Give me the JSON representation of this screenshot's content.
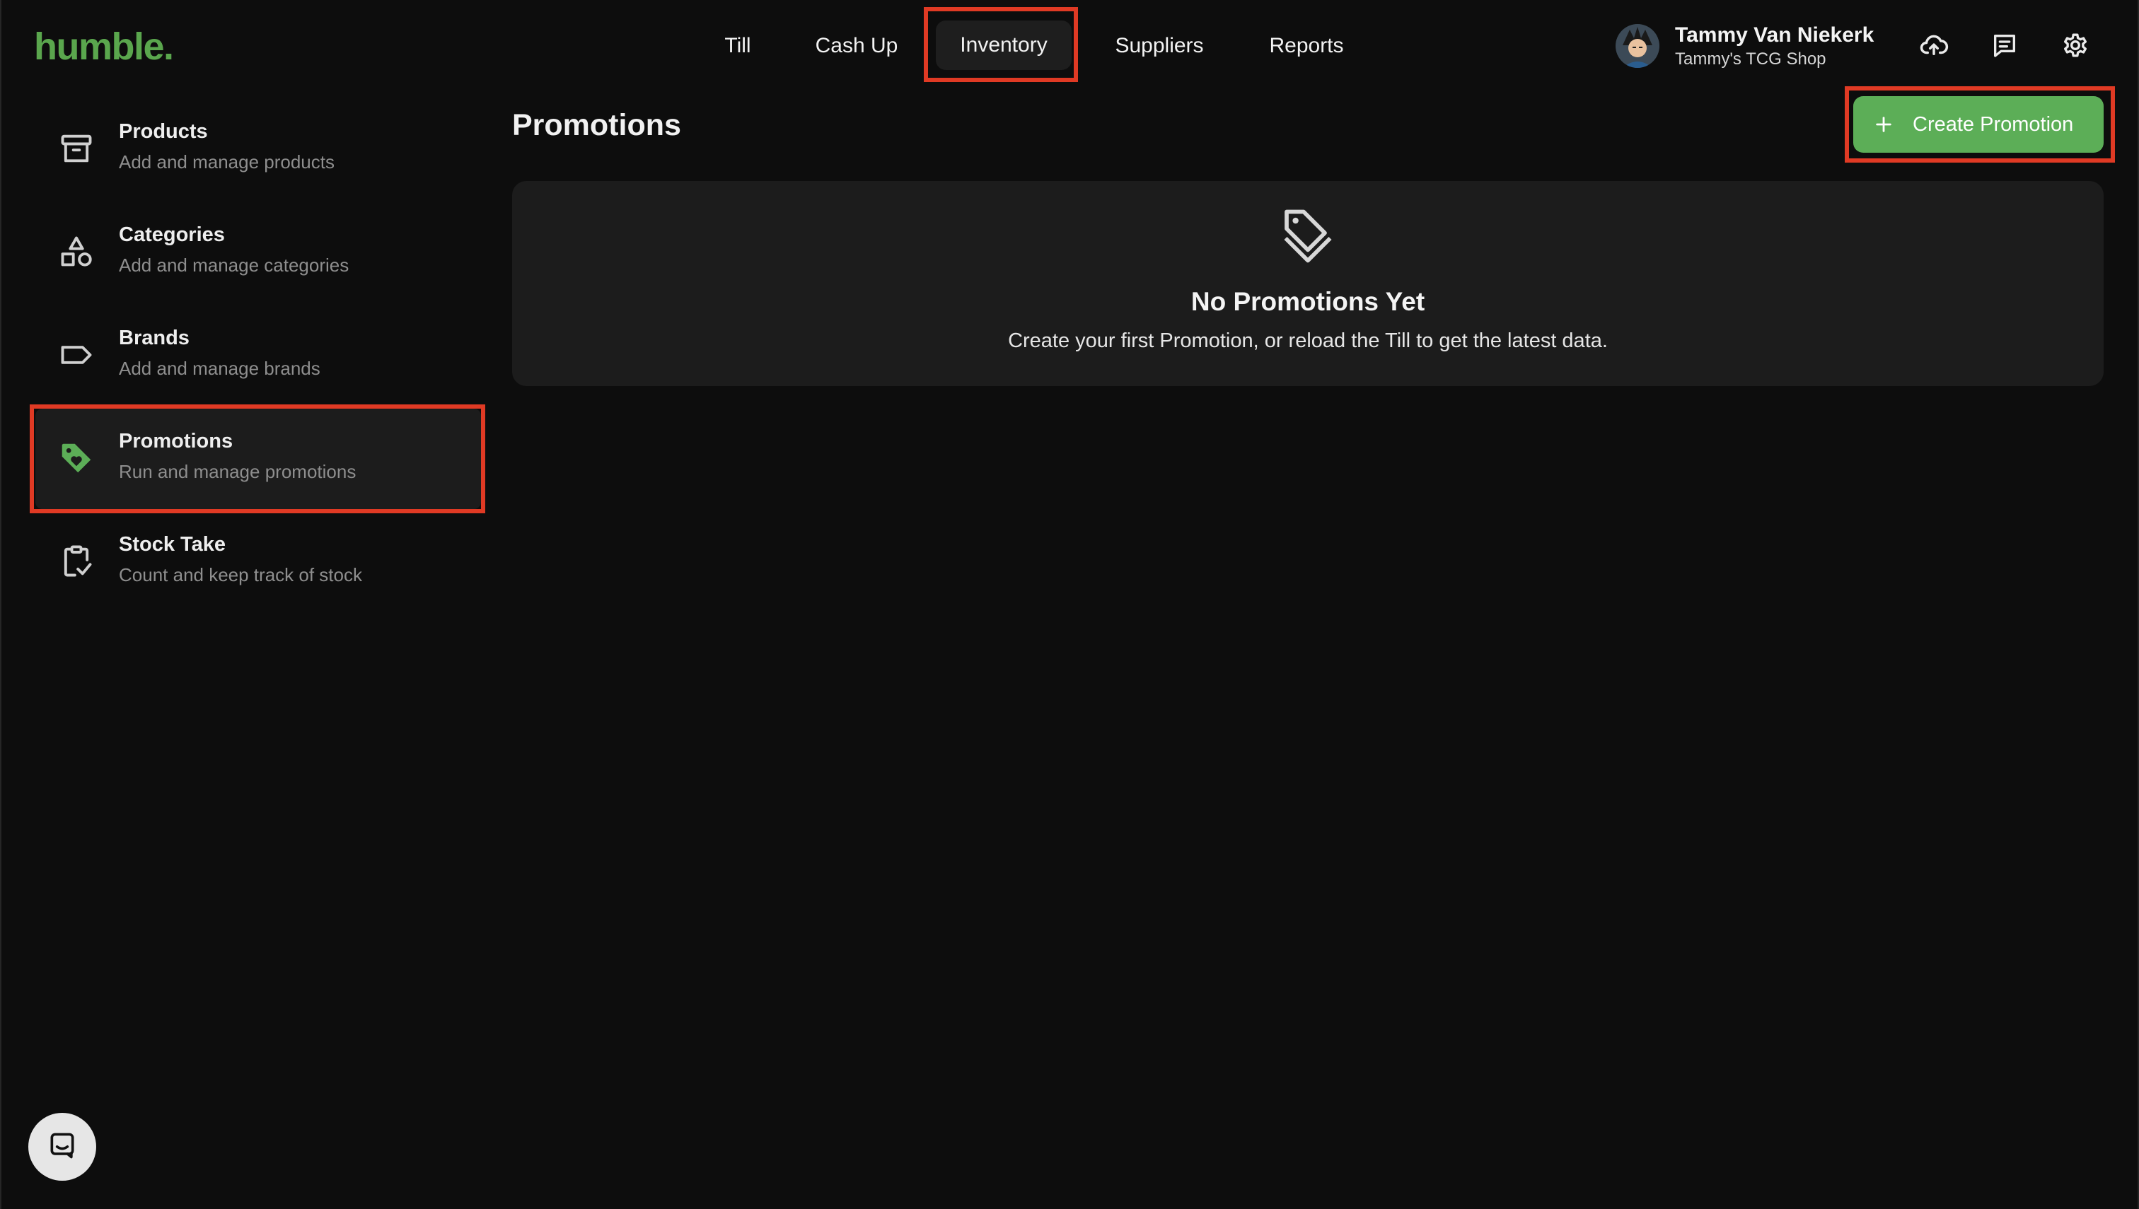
{
  "app": {
    "logo_text": "humble.",
    "brand_color": "#5aa64d",
    "accent_highlight_color": "#e03a24"
  },
  "topnav": {
    "items": [
      {
        "label": "Till",
        "icon": null
      },
      {
        "label": "Cash Up",
        "icon": null
      },
      {
        "label": "Inventory",
        "icon": null,
        "active": true
      },
      {
        "label": "Suppliers",
        "icon": null
      },
      {
        "label": "Reports",
        "icon": null
      }
    ]
  },
  "user": {
    "name": "Tammy Van Niekerk",
    "shop": "Tammy's TCG Shop",
    "icons": [
      "cloud-upload-icon",
      "message-icon",
      "gear-icon"
    ]
  },
  "sidebar": {
    "items": [
      {
        "title": "Products",
        "subtitle": "Add and manage products",
        "icon": "archive-box-icon"
      },
      {
        "title": "Categories",
        "subtitle": "Add and manage categories",
        "icon": "shapes-icon"
      },
      {
        "title": "Brands",
        "subtitle": "Add and manage brands",
        "icon": "label-tag-icon"
      },
      {
        "title": "Promotions",
        "subtitle": "Run and manage promotions",
        "icon": "promo-tag-icon",
        "active": true
      },
      {
        "title": "Stock Take",
        "subtitle": "Count and keep track of stock",
        "icon": "clipboard-check-icon"
      }
    ]
  },
  "main": {
    "title": "Promotions",
    "create_button_label": "Create Promotion",
    "empty_state": {
      "icon": "tags-icon",
      "title": "No Promotions Yet",
      "message": "Create your first Promotion, or reload the Till to get the latest data."
    }
  },
  "support": {
    "icon": "chat-bubble-icon"
  }
}
